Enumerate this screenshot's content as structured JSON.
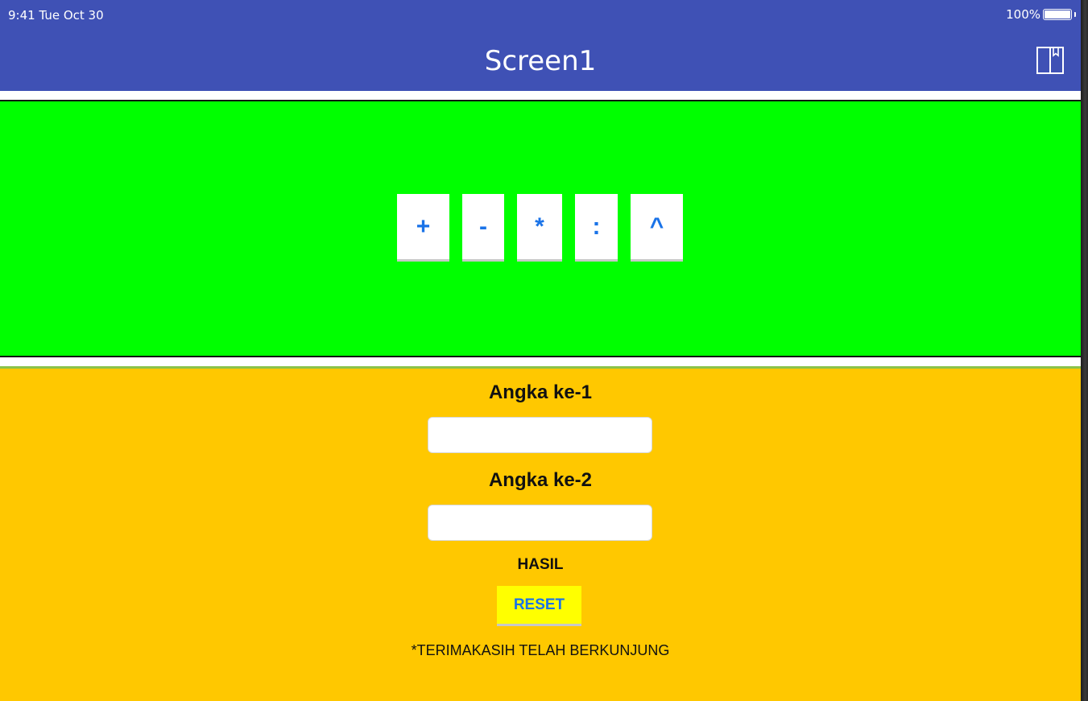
{
  "status_bar": {
    "time": "9:41 Tue Oct 30",
    "battery_text": "100%",
    "battery_level": 1.0
  },
  "title_bar": {
    "title": "Screen1",
    "icon": "book-icon",
    "background": "#3f51b5"
  },
  "operators": {
    "background": "#00ff00",
    "buttons": [
      {
        "label": "+",
        "name": "plus"
      },
      {
        "label": "-",
        "name": "minus"
      },
      {
        "label": "*",
        "name": "multiply"
      },
      {
        "label": ":",
        "name": "divide"
      },
      {
        "label": "^",
        "name": "power"
      }
    ]
  },
  "form": {
    "background": "#ffc800",
    "first_label": "Angka ke-1",
    "first_value": "",
    "second_label": "Angka ke-2",
    "second_value": "",
    "result_label": "HASIL",
    "reset_label": "RESET",
    "footer_text": "*TERIMAKASIH TELAH BERKUNJUNG"
  }
}
